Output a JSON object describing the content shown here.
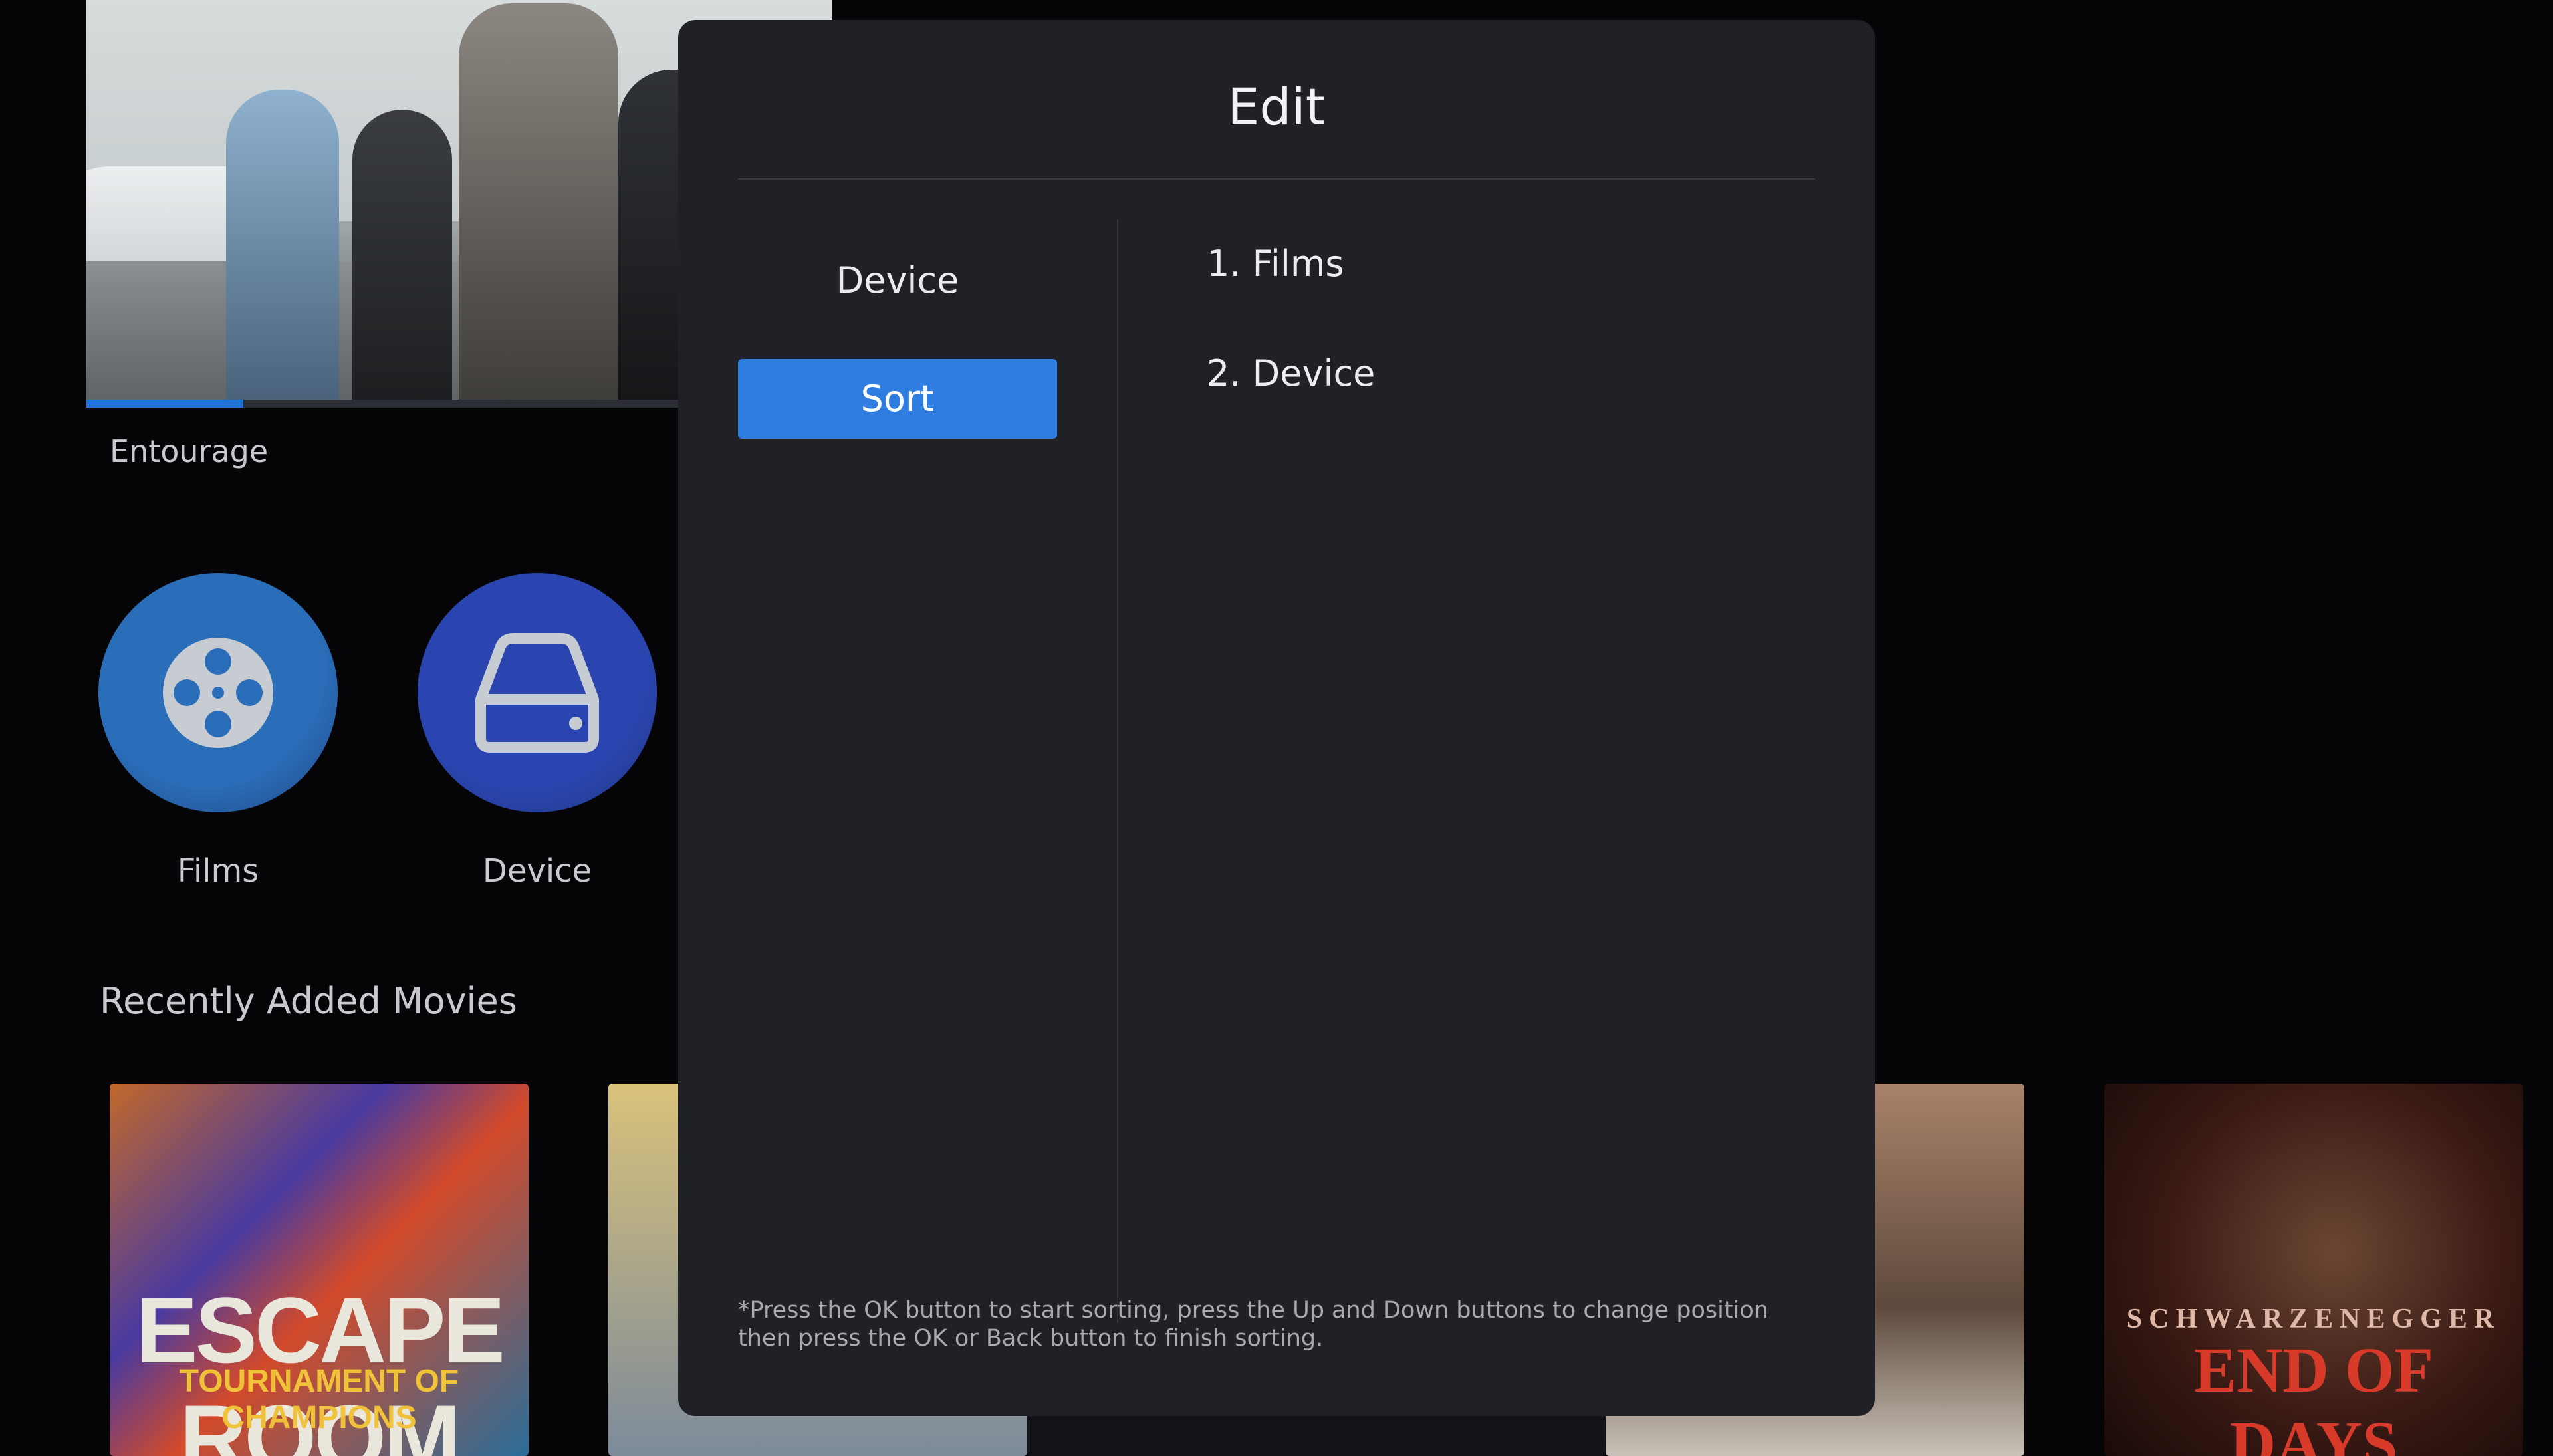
{
  "hero": {
    "title": "Entourage",
    "progress": 0.21
  },
  "library": {
    "items": [
      {
        "label": "Films",
        "icon": "film-reel-icon",
        "color": "#2a6db8"
      },
      {
        "label": "Device",
        "icon": "hard-drive-icon",
        "color": "#2a45b0"
      }
    ]
  },
  "recently_added": {
    "title": "Recently Added Movies",
    "posters": [
      {
        "title": "ESCAPE ROOM",
        "subtitle": "TOURNAMENT OF CHAMPIONS"
      },
      {
        "title": "",
        "subtitle": ""
      },
      {
        "title": "",
        "subtitle": ""
      },
      {
        "title": "",
        "subtitle": ""
      },
      {
        "title": "END OF DAYS",
        "subtitle": "SCHWARZENEGGER"
      }
    ]
  },
  "dialog": {
    "title": "Edit",
    "menu": [
      {
        "label": "Device",
        "active": false
      },
      {
        "label": "Sort",
        "active": true
      }
    ],
    "sort_list": [
      "1. Films",
      "2. Device"
    ],
    "hint": "*Press the OK button to start sorting, press the Up and Down buttons to change position then press the OK or Back button to finish sorting."
  }
}
